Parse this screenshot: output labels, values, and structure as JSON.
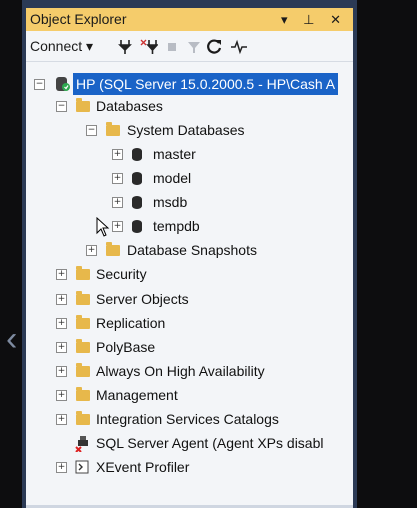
{
  "window": {
    "title": "Object Explorer",
    "pin": "▾ ⊥ ✕"
  },
  "toolbar": {
    "connect": "Connect ▾",
    "icons": [
      "connect-icon",
      "disconnect-icon",
      "stop-icon",
      "filter-icon",
      "refresh-icon",
      "activity-icon"
    ]
  },
  "tree": {
    "server": "HP (SQL Server 15.0.2000.5 - HP\\Cash A",
    "databases": "Databases",
    "system_databases": "System Databases",
    "master": "master",
    "model": "model",
    "msdb": "msdb",
    "tempdb": "tempdb",
    "snapshots": "Database Snapshots",
    "security": "Security",
    "server_objects": "Server Objects",
    "replication": "Replication",
    "polybase": "PolyBase",
    "always_on": "Always On High Availability",
    "management": "Management",
    "integration": "Integration Services Catalogs",
    "agent": "SQL Server Agent (Agent XPs disabl",
    "xevent": "XEvent Profiler"
  },
  "colors": {
    "accent": "#1a63c7",
    "titlebar": "#f5cc6b",
    "panel": "#2b3a55"
  }
}
